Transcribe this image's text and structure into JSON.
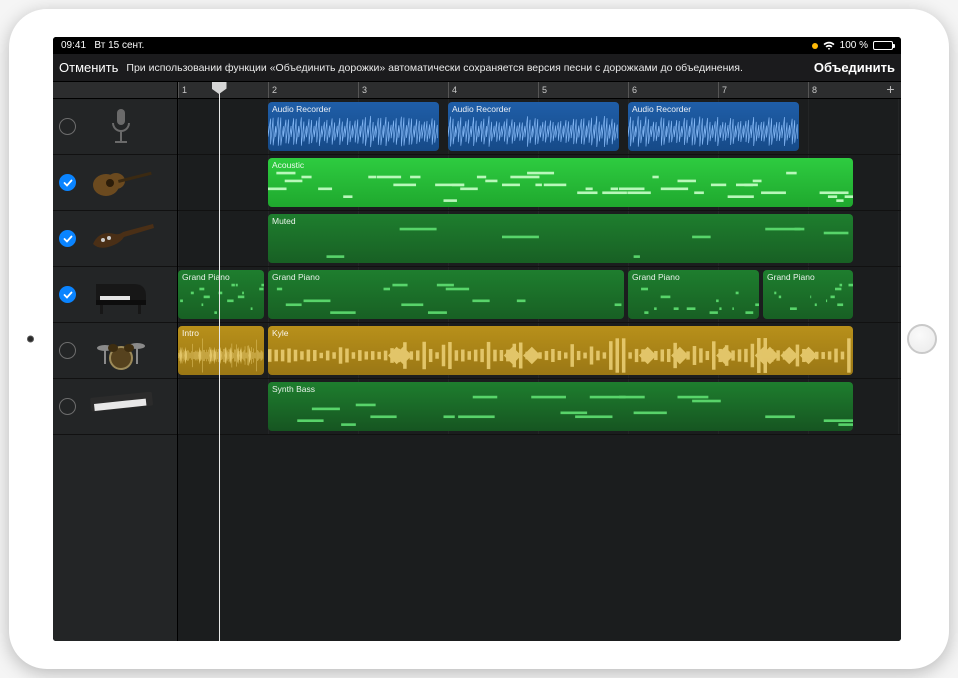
{
  "statusbar": {
    "time": "09:41",
    "date": "Вт 15 сент.",
    "battery_pct": "100 %"
  },
  "toolbar": {
    "cancel": "Отменить",
    "message": "При использовании функции «Объединить дорожки» автоматически сохраняется версия песни с дорожками до объединения.",
    "merge": "Объединить"
  },
  "ruler": {
    "bars": [
      "1",
      "2",
      "3",
      "4",
      "5",
      "6",
      "7",
      "8"
    ]
  },
  "tracks": [
    {
      "id": "mic",
      "selected": false,
      "icon": "microphone"
    },
    {
      "id": "acoustic",
      "selected": true,
      "icon": "acoustic-guitar"
    },
    {
      "id": "bass",
      "selected": true,
      "icon": "bass-guitar"
    },
    {
      "id": "piano",
      "selected": true,
      "icon": "grand-piano"
    },
    {
      "id": "drums",
      "selected": false,
      "icon": "drum-kit"
    },
    {
      "id": "synth",
      "selected": false,
      "icon": "keyboard-synth"
    }
  ],
  "regions": {
    "mic": [
      {
        "label": "Audio Recorder",
        "start": 2,
        "end": 3.9,
        "type": "audio"
      },
      {
        "label": "Audio Recorder",
        "start": 4,
        "end": 5.9,
        "type": "audio"
      },
      {
        "label": "Audio Recorder",
        "start": 6,
        "end": 7.9,
        "type": "audio"
      }
    ],
    "acoustic": [
      {
        "label": "Acoustic",
        "start": 2,
        "end": 8.5,
        "type": "midi-bright"
      }
    ],
    "bass": [
      {
        "label": "Muted",
        "start": 2,
        "end": 8.5,
        "type": "midi-dark"
      }
    ],
    "piano": [
      {
        "label": "Grand Piano",
        "start": 1,
        "end": 1.95,
        "type": "midi-dark"
      },
      {
        "label": "Grand Piano",
        "start": 2,
        "end": 5.95,
        "type": "midi-dark"
      },
      {
        "label": "Grand Piano",
        "start": 6,
        "end": 7.45,
        "type": "midi-dark"
      },
      {
        "label": "Grand Piano",
        "start": 7.5,
        "end": 8.5,
        "type": "midi-dark"
      }
    ],
    "drums": [
      {
        "label": "Intro",
        "start": 1,
        "end": 1.95,
        "type": "drum"
      },
      {
        "label": "Kyle",
        "start": 2,
        "end": 8.5,
        "type": "drum"
      }
    ],
    "synth": [
      {
        "label": "Synth Bass",
        "start": 2,
        "end": 8.5,
        "type": "midi-dark2"
      }
    ]
  },
  "playhead_bar": 1.45,
  "colors": {
    "accent": "#0a84ff"
  }
}
